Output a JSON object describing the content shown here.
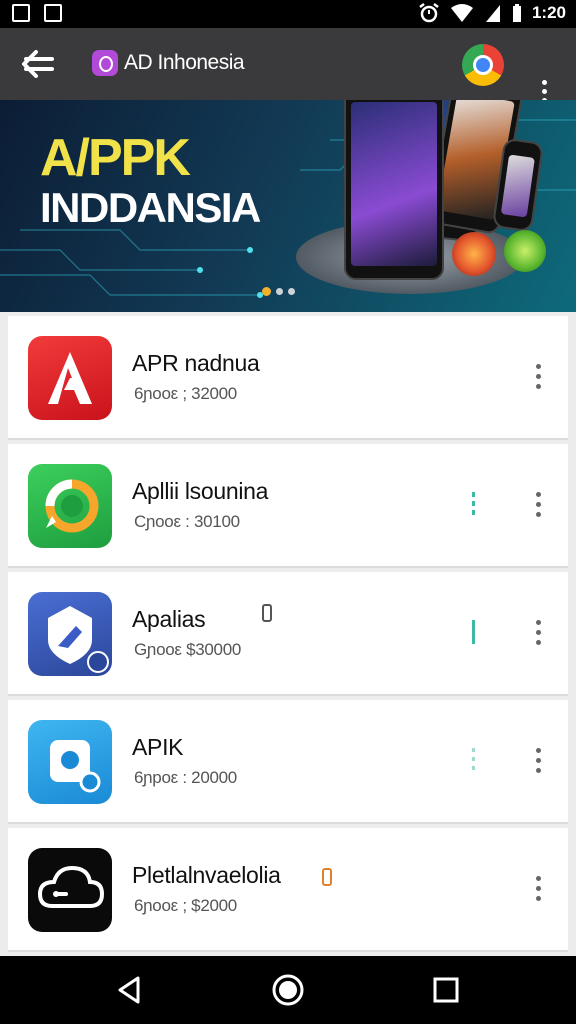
{
  "status_bar": {
    "time": "1:20",
    "icons": [
      "image-icon",
      "photo-icon",
      "alarm-icon",
      "wifi-icon",
      "signal-icon",
      "battery-icon"
    ]
  },
  "app_bar": {
    "title": "AD Inhonesia",
    "back_icon": "arrow-left-icon",
    "chrome_icon": "chrome-icon",
    "menu_icon": "more-vert-icon"
  },
  "banner": {
    "headline_1": "A/PPK",
    "headline_2": "INDDANSIA",
    "page_count": 3,
    "active_page": 1
  },
  "apps": [
    {
      "name": "APR nadnua",
      "subtitle": "6ɲoοε ; 32000",
      "icon": "adobe-a-icon",
      "extra": ""
    },
    {
      "name": "Apllii lsounina",
      "subtitle": "Cɲoοε : 30100",
      "icon": "whatsapp-ring-icon",
      "extra": ""
    },
    {
      "name": "Apalias",
      "subtitle": "Gɲoοε $30000",
      "icon": "shield-bird-icon",
      "extra": ""
    },
    {
      "name": "APIK",
      "subtitle": "6ɲpοε : 20000",
      "icon": "camera-square-icon",
      "extra": ""
    },
    {
      "name": "Pletlalnvaelolia",
      "subtitle": "6ɲooε ; $2000",
      "icon": "cloud-icon",
      "extra": ""
    }
  ],
  "nav_bar": {
    "buttons": [
      "back-triangle-icon",
      "home-circle-icon",
      "recents-square-icon"
    ]
  },
  "colors": {
    "app_bar": "#3a3a3c",
    "banner_yellow": "#f2e24a",
    "accent_teal": "#3fb8a4"
  }
}
